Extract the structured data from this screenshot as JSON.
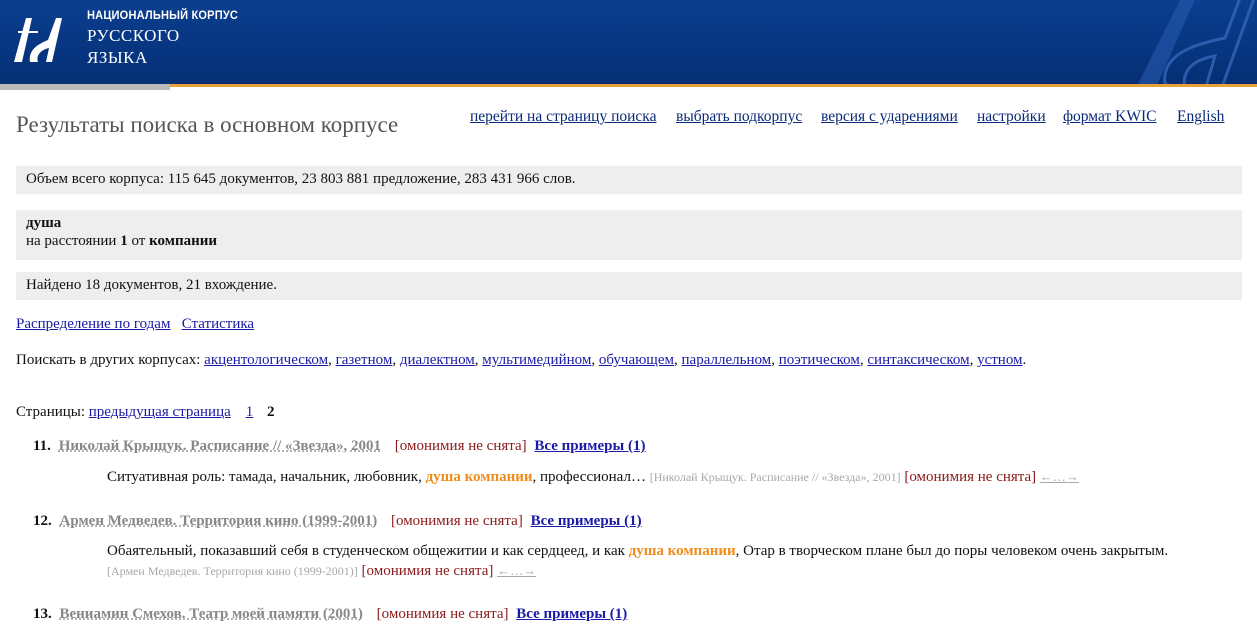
{
  "header": {
    "logo_line1": "НАЦИОНАЛЬНЫЙ КОРПУС",
    "logo_line2": "РУССКОГО",
    "logo_line3": "ЯЗЫКА",
    "colors": {
      "header_blue": "#073580",
      "accent_orange": "#e8a13a"
    }
  },
  "title": "Результаты поиска в основном корпусе",
  "nav": [
    {
      "label": "перейти на страницу поиска"
    },
    {
      "label": "выбрать подкорпус"
    },
    {
      "label": "версия с ударениями"
    },
    {
      "label": "настройки"
    },
    {
      "label": "формат KWIC"
    },
    {
      "label": "English"
    }
  ],
  "corpus_size": "Объем всего корпуса: 115 645 документов, 23 803 881 предложение, 283 431 966 слов.",
  "query": {
    "word": "душа",
    "distance_prefix": "на расстоянии",
    "distance_value": "1",
    "distance_mid": "от",
    "distance_word": "компании"
  },
  "found": "Найдено 18 документов, 21 вхождение.",
  "stats_links": [
    "Распределение по годам",
    "Статистика"
  ],
  "other_corpora": {
    "label": "Поискать в других корпусах:",
    "items": [
      "акцентологическом",
      "газетном",
      "диалектном",
      "мультимедийном",
      "обучающем",
      "параллельном",
      "поэтическом",
      "синтаксическом",
      "устном"
    ],
    "end": "."
  },
  "pages": {
    "label": "Страницы:",
    "prev": "предыдущая страница",
    "p1": "1",
    "current": "2"
  },
  "homonymy": "[омонимия не снята]",
  "all_examples": "Все примеры (1)",
  "arrows": "←…→",
  "results": [
    {
      "num": "11.",
      "title": "Николай Крыщук. Расписание // «Звезда», 2001",
      "before": "Ситуативная роль: тамада, начальник, любовник, ",
      "hit": "душа компании",
      "after": ", профессионал… ",
      "source": "[Николай Крыщук. Расписание // «Звезда», 2001]"
    },
    {
      "num": "12.",
      "title": "Армен Медведев. Территория кино (1999-2001)",
      "before": "Обаятельный, показавший себя в студенческом общежитии и как сердцеед, и как ",
      "hit": "душа компании",
      "after": ", Отар в творческом плане был до поры человеком очень закрытым. ",
      "source": "[Армен Медведев. Территория кино (1999-2001)]"
    },
    {
      "num": "13.",
      "title": "Вениамин Смехов. Театр моей памяти (2001)"
    }
  ]
}
